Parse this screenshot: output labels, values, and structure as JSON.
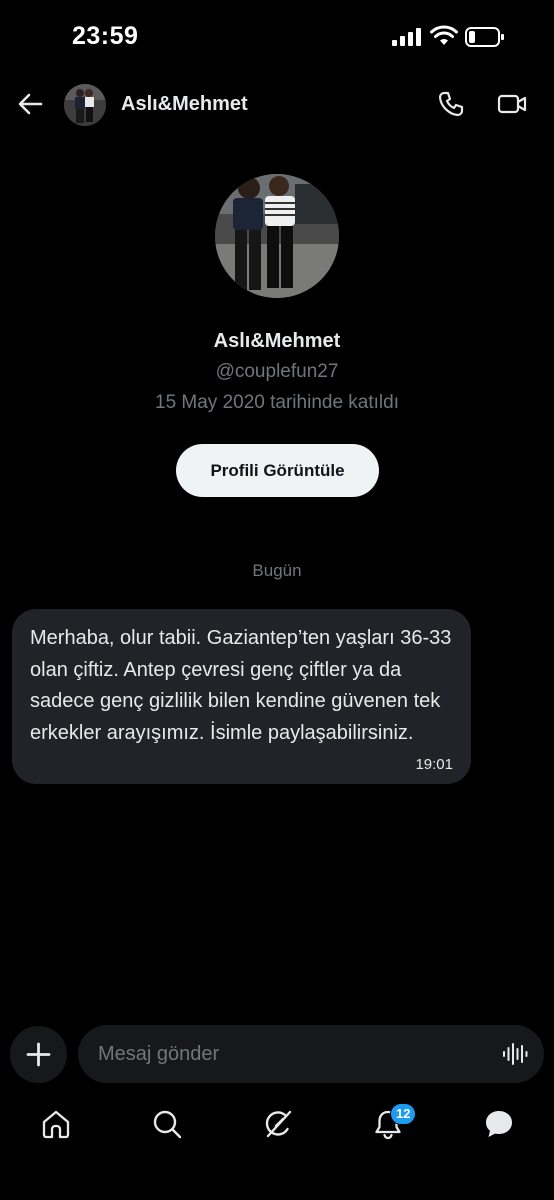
{
  "status_bar": {
    "time": "23:59"
  },
  "header": {
    "title": "Aslı&Mehmet"
  },
  "profile": {
    "name": "Aslı&Mehmet",
    "handle": "@couplefun27",
    "joined": "15 May 2020 tarihinde katıldı",
    "view_profile_label": "Profili Görüntüle"
  },
  "conversation": {
    "date_divider": "Bugün",
    "messages": [
      {
        "text": "Merhaba, olur tabii. Gaziantep’ten yaşları 36-33 olan çiftiz. Antep çevresi genç çiftler ya da sadece genç gizlilik bilen kendine güvenen tek erkekler arayışımız. İsimle paylaşabilirsiniz.",
        "time": "19:01"
      }
    ]
  },
  "composer": {
    "placeholder": "Mesaj gönder"
  },
  "bottom_nav": {
    "items": [
      "home-icon",
      "search-icon",
      "grok-icon",
      "bell-icon",
      "messages-icon"
    ],
    "notification_count": "12"
  },
  "colors": {
    "background": "#000000",
    "bubble": "#202327",
    "muted_text": "#71767b",
    "accent": "#1d9bf0"
  }
}
